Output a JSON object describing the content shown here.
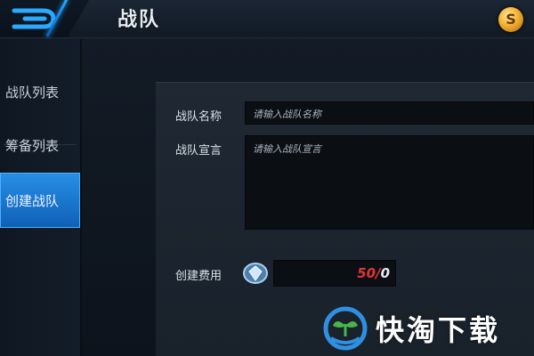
{
  "header": {
    "title": "战队",
    "back_icon": "back-arrow-icon",
    "coin_icon": "coin-icon",
    "coin_glyph": "S"
  },
  "sidebar": {
    "items": [
      {
        "label": "战队列表",
        "active": false
      },
      {
        "label": "筹备列表",
        "active": false
      },
      {
        "label": "创建战队",
        "active": true
      }
    ]
  },
  "form": {
    "name": {
      "label": "战队名称",
      "placeholder": "请输入战队名称"
    },
    "declaration": {
      "label": "战队宣言",
      "placeholder": "请输入战队宣言"
    },
    "cost": {
      "label": "创建费用",
      "have": "50",
      "separator": "/",
      "need": "0",
      "icon": "diamond-icon"
    }
  },
  "watermark": {
    "text": "快淘下载",
    "icon": "leaf-logo-icon"
  },
  "colors": {
    "accent": "#1e8be8",
    "insufficient": "#e23535",
    "panel": "#1f2833"
  }
}
